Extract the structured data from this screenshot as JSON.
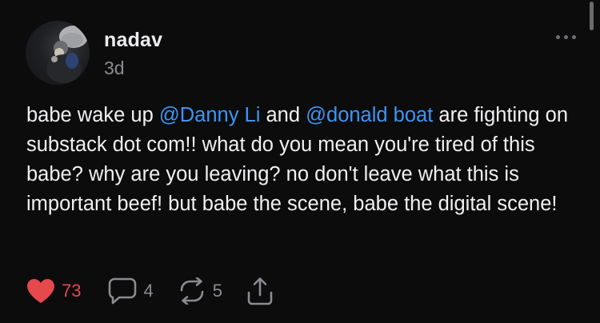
{
  "note": {
    "author": "nadav",
    "timestamp": "3d",
    "body": [
      {
        "type": "text",
        "value": "babe wake up "
      },
      {
        "type": "mention",
        "value": "@Danny Li"
      },
      {
        "type": "text",
        "value": " and "
      },
      {
        "type": "mention",
        "value": "@donald boat"
      },
      {
        "type": "text",
        "value": " are fighting on substack dot com!! what do you mean you're tired of this babe? why are you leaving? no don't leave what this is important beef! but babe the scene, babe the digital scene!"
      }
    ]
  },
  "actions": {
    "like": {
      "icon": "heart-icon",
      "count": "73",
      "color": "#e5484d"
    },
    "comment": {
      "icon": "comment-icon",
      "count": "4"
    },
    "restack": {
      "icon": "restack-icon",
      "count": "5"
    },
    "share": {
      "icon": "share-icon"
    }
  },
  "colors": {
    "background": "#0c0c0d",
    "mention": "#3d95f4",
    "muted": "#8b8b90"
  }
}
